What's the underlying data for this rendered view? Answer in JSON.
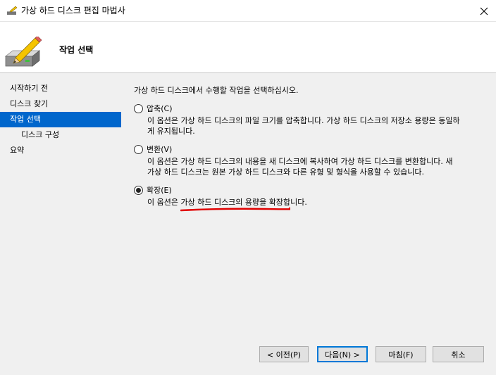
{
  "window": {
    "title": "가상 하드 디스크 편집 마법사",
    "close_glyph": "✕"
  },
  "header": {
    "title": "작업 선택"
  },
  "sidebar": {
    "items": [
      {
        "label": "시작하기 전"
      },
      {
        "label": "디스크 찾기"
      },
      {
        "label": "작업 선택",
        "selected": true
      },
      {
        "label": "디스크 구성",
        "indent": true
      },
      {
        "label": "요약"
      }
    ]
  },
  "main": {
    "intro": "가상 하드 디스크에서 수행할 작업을 선택하십시오.",
    "options": [
      {
        "label": "압축(C)",
        "checked": false,
        "desc_line1": "이 옵션은 가상 하드 디스크의 파일 크기를 압축합니다. 가상 하드 디스크의 저장소 용량은 동일하",
        "desc_line2": "게 유지됩니다."
      },
      {
        "label": "변환(V)",
        "checked": false,
        "desc_line1": "이 옵션은 가상 하드 디스크의 내용을 새 디스크에 복사하여 가상 하드 디스크를 변환합니다. 새",
        "desc_line2": "가상 하드 디스크는 원본 가상 하드 디스크와 다른 유형 및 형식을 사용할 수 있습니다."
      },
      {
        "label": "확장(E)",
        "checked": true,
        "desc_line1": "이 옵션은 가상 하드 디스크의 용량을 확장합니다.",
        "desc_line2": ""
      }
    ],
    "annotation_color": "#e00000"
  },
  "buttons": {
    "prev": "< 이전(P)",
    "next": "다음(N) >",
    "finish": "마침(F)",
    "cancel": "취소"
  },
  "colors": {
    "selection": "#0066cc",
    "default_button_border": "#0078d7"
  }
}
